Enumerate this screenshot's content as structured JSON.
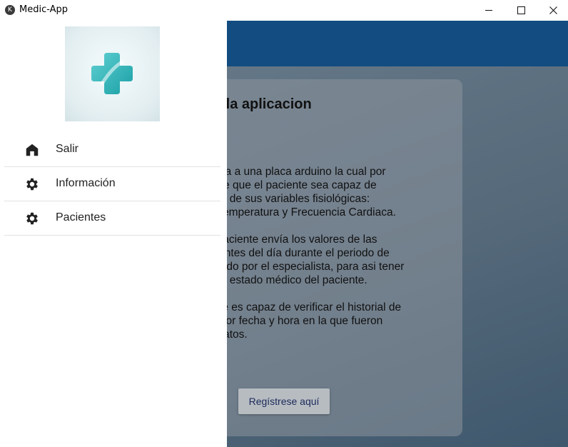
{
  "window": {
    "title": "Medic-App",
    "icon_glyph": "K"
  },
  "card": {
    "title": "o de la aplicacion",
    "paragraphs": [
      [
        "conecta a una placa arduino la cual por",
        "permite que el paciente sea capaz de",
        "de tres de sus variables fisiológicas:",
        "eno, Temperatura y Frecuencia Cardiaca."
      ],
      [
        "n, el paciente envía los valores de las",
        "s instantes del día durante el periodo de",
        "erminado por el especialista, para asi tener",
        "reo del estado médico del paciente."
      ],
      [
        "aciente es capaz de verificar el historial de",
        "ados por fecha y hora en la que fueron",
        "e de datos."
      ]
    ],
    "register_button": "Regístrese aquí"
  },
  "drawer": {
    "items": [
      {
        "label": "Salir",
        "icon": "home-icon"
      },
      {
        "label": "Información",
        "icon": "gear-icon"
      },
      {
        "label": "Pacientes",
        "icon": "gear-icon"
      }
    ]
  },
  "colors": {
    "appbar": "#124c80",
    "drawer": "#ffffff",
    "logo_cross": "#2fb4b8"
  }
}
